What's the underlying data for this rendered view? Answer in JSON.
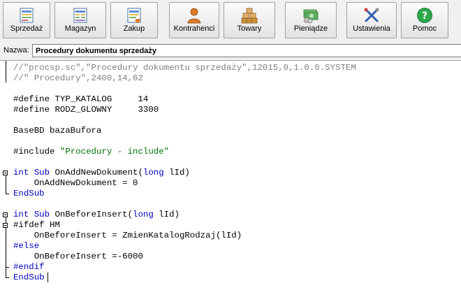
{
  "toolbar": {
    "buttons": [
      {
        "label": "Sprzedaż",
        "icon": "sales-document-icon"
      },
      {
        "label": "Magazyn",
        "icon": "warehouse-document-icon"
      },
      {
        "label": "Zakup",
        "icon": "purchase-document-icon"
      },
      {
        "label": "Kontrahenci",
        "icon": "person-icon"
      },
      {
        "label": "Towary",
        "icon": "boxes-icon"
      },
      {
        "label": "Pieniądze",
        "icon": "money-icon"
      },
      {
        "label": "Ustawienia",
        "icon": "tools-icon"
      },
      {
        "label": "Pomoc",
        "icon": "help-icon"
      }
    ],
    "colors": {
      "person": "#e07a28",
      "boxes": "#c8913c",
      "money": "#3c9a3c",
      "tools": "#2f5fb0",
      "help": "#2aa84a"
    }
  },
  "name_field": {
    "label": "Nazwa:",
    "value": "Procedury dokumentu sprzedaży"
  },
  "editor": {
    "lines": [
      [
        {
          "t": "//\"procsp.sc\",\"Procedury dokumentu sprzedaży\",12015,0,1.0.0.SYSTEM",
          "c": "comment"
        }
      ],
      [
        {
          "t": "//\" Procedury\",2400,14,62",
          "c": "comment"
        }
      ],
      [],
      [
        {
          "t": "#define TYP_KATALOG     14",
          "c": "text"
        }
      ],
      [
        {
          "t": "#define RODZ_GLOWNY     3300",
          "c": "text"
        }
      ],
      [],
      [
        {
          "t": "BaseBD bazaBufora",
          "c": "text"
        }
      ],
      [],
      [
        {
          "t": "#include ",
          "c": "text"
        },
        {
          "t": "\"Procedury - include\"",
          "c": "str"
        }
      ],
      [],
      [
        {
          "t": "int",
          "c": "kw"
        },
        {
          "t": " ",
          "c": "text"
        },
        {
          "t": "Sub",
          "c": "kw"
        },
        {
          "t": " OnAddNewDokument(",
          "c": "text"
        },
        {
          "t": "long",
          "c": "kw"
        },
        {
          "t": " lId)",
          "c": "text"
        }
      ],
      [
        {
          "t": "    OnAddNewDokument = 0",
          "c": "text"
        }
      ],
      [
        {
          "t": "EndSub",
          "c": "kw"
        }
      ],
      [],
      [
        {
          "t": "int",
          "c": "kw"
        },
        {
          "t": " ",
          "c": "text"
        },
        {
          "t": "Sub",
          "c": "kw"
        },
        {
          "t": " OnBeforeInsert(",
          "c": "text"
        },
        {
          "t": "long",
          "c": "kw"
        },
        {
          "t": " lId)",
          "c": "text"
        }
      ],
      [
        {
          "t": "#ifdef HM",
          "c": "text"
        }
      ],
      [
        {
          "t": "    OnBeforeInsert = ZmienKatalogRodzaj(lId)",
          "c": "text"
        }
      ],
      [
        {
          "t": "#else",
          "c": "kw"
        }
      ],
      [
        {
          "t": "    OnBeforeInsert =-6000",
          "c": "text"
        }
      ],
      [
        {
          "t": "#endif",
          "c": "kw"
        }
      ],
      [
        {
          "t": "EndSub",
          "c": "kw"
        }
      ]
    ]
  }
}
